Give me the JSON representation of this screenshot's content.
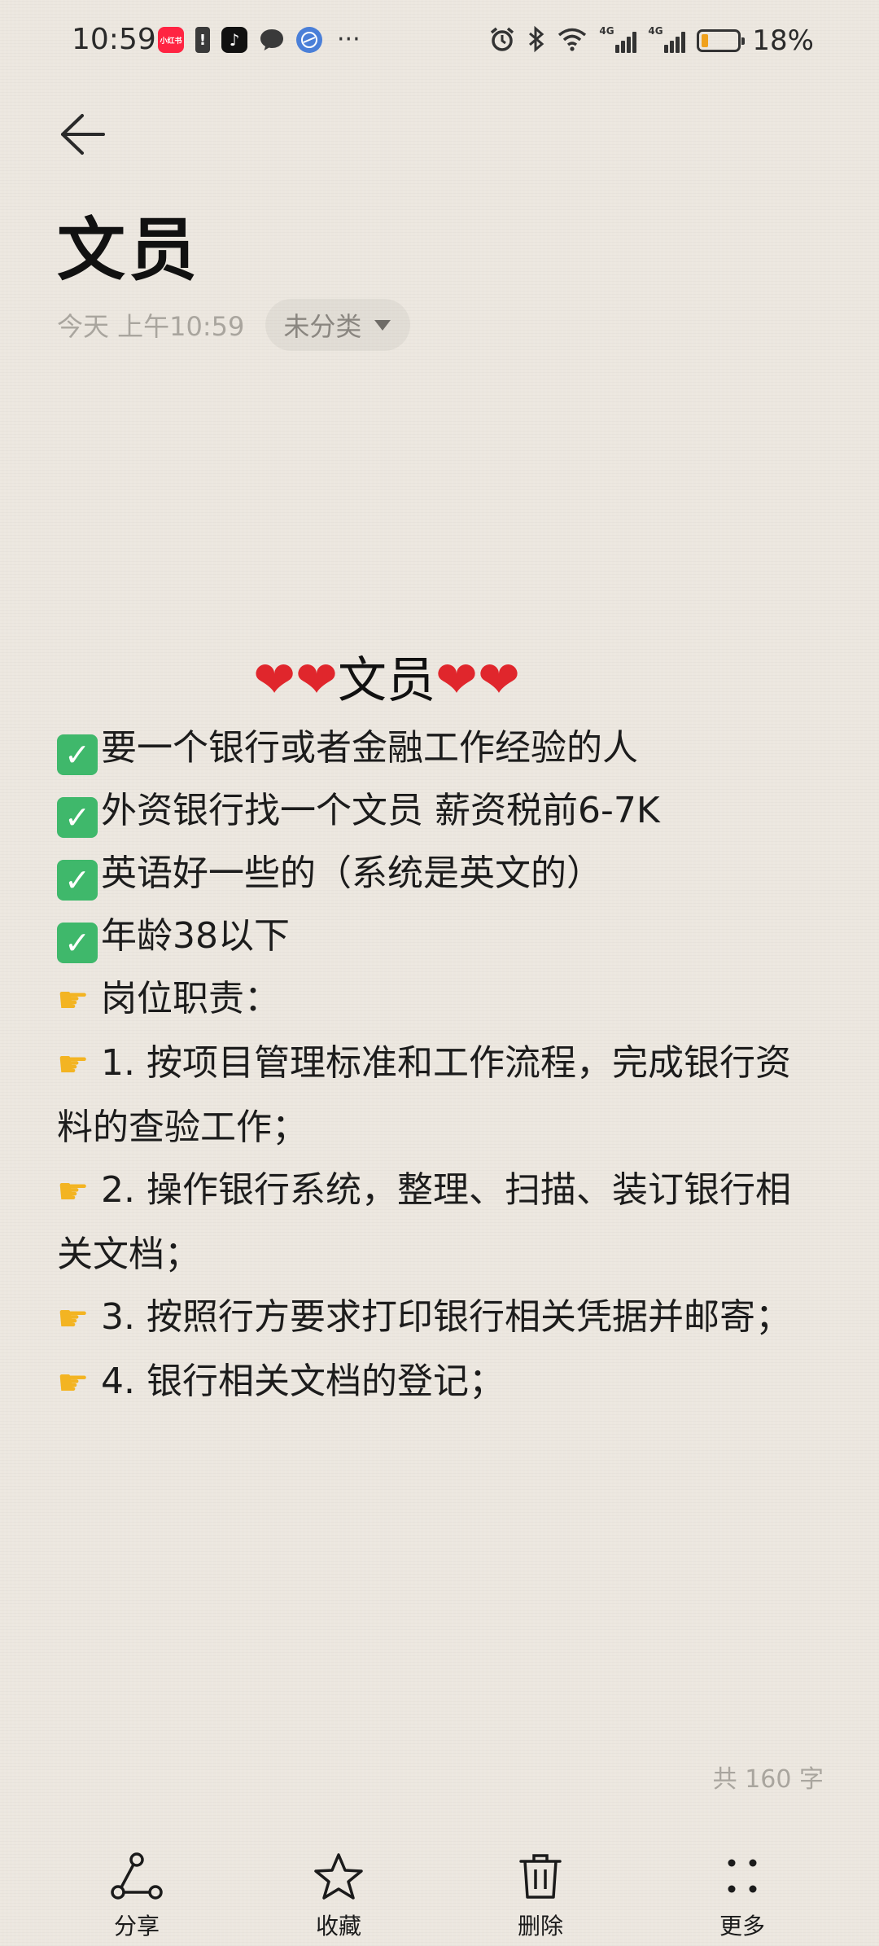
{
  "status_bar": {
    "time": "10:59",
    "app_icons": [
      "xiaohongshu-icon",
      "warning-icon",
      "tiktok-icon",
      "message-icon",
      "browser-icon"
    ],
    "more_dots": "···",
    "battery_percent": "18%",
    "battery_level": 0.18,
    "network_tags": [
      "4G",
      "4G"
    ],
    "battery_color": "#f0a11c"
  },
  "header": {
    "title": "文员",
    "timestamp": "今天 上午10:59",
    "category": "未分类"
  },
  "body": {
    "heading_text": "文员",
    "lines": [
      {
        "emoji": "check",
        "text": "要一个银行或者金融工作经验的人"
      },
      {
        "emoji": "check",
        "text": "外资银行找一个文员 薪资税前6-7K"
      },
      {
        "emoji": "check",
        "text": "英语好一些的（系统是英文的）"
      },
      {
        "emoji": "check",
        "text": "年龄38以下"
      },
      {
        "emoji": "point",
        "text": "岗位职责："
      },
      {
        "emoji": "point",
        "text": "1. 按项目管理标准和工作流程，完成银行资"
      },
      {
        "emoji": "",
        "text": "料的查验工作；"
      },
      {
        "emoji": "point",
        "text": "2. 操作银行系统，整理、扫描、装订银行相"
      },
      {
        "emoji": "",
        "text": "关文档；"
      },
      {
        "emoji": "point",
        "text": "3. 按照行方要求打印银行相关凭据并邮寄；"
      },
      {
        "emoji": "point",
        "text": "4. 银行相关文档的登记；"
      }
    ]
  },
  "word_count": "共 160 字",
  "bottom_bar": {
    "share_label": "分享",
    "favorite_label": "收藏",
    "delete_label": "删除",
    "more_label": "更多"
  },
  "colors": {
    "background": "#ece7df",
    "heart": "#e0262c",
    "check": "#3fb86b",
    "muted_text": "#a9a59e"
  }
}
